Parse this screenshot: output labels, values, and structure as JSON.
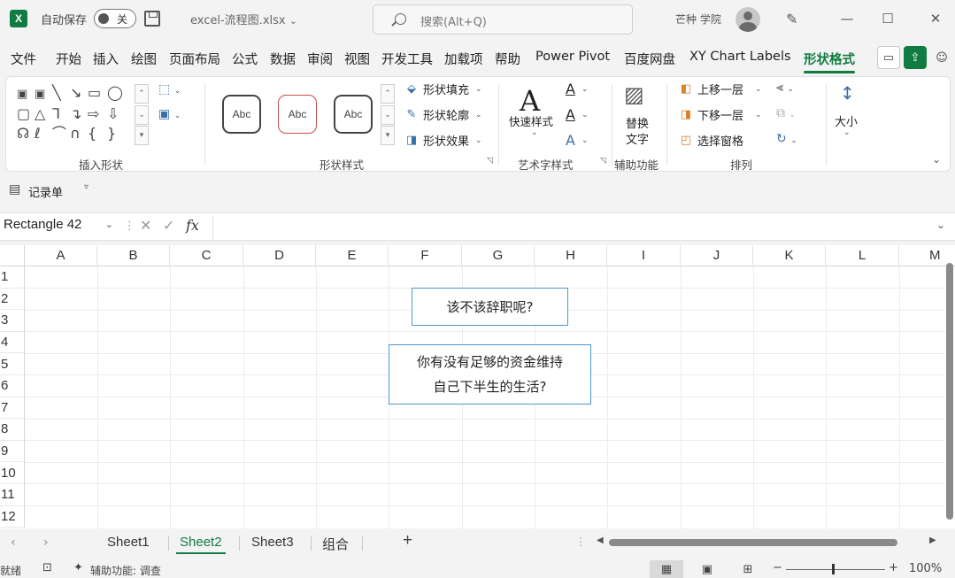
{
  "titlebar": {
    "logo": "X",
    "autosave_label": "自动保存",
    "autosave_state": "关",
    "filename": "excel-流程图.xlsx",
    "filename_caret": "⌄",
    "search_placeholder": "搜索(Alt+Q)",
    "username": "芒种 学院",
    "minimize": "—",
    "maximize": "☐",
    "close": "✕"
  },
  "menu": {
    "tabs": [
      "文件",
      "开始",
      "插入",
      "绘图",
      "页面布局",
      "公式",
      "数据",
      "审阅",
      "视图",
      "开发工具",
      "加载项",
      "帮助",
      "Power Pivot",
      "百度网盘",
      "XY Chart Labels",
      "形状格式"
    ],
    "active_tab": "形状格式"
  },
  "ribbon": {
    "groups": {
      "insert_shapes": "插入形状",
      "shape_styles": "形状样式",
      "wordart_styles": "艺术字样式",
      "accessibility": "辅助功能",
      "arrange": "排列"
    },
    "abc_samples": [
      "Abc",
      "Abc",
      "Abc"
    ],
    "shape_fill": "形状填充",
    "shape_outline": "形状轮廓",
    "shape_effects": "形状效果",
    "quick_styles": "快速样式",
    "alt_text_line1": "替换",
    "alt_text_line2": "文字",
    "bring_forward": "上移一层",
    "send_backward": "下移一层",
    "selection_pane": "选择窗格",
    "size": "大小"
  },
  "qat": {
    "form_label": "记录单"
  },
  "formula_bar": {
    "name_box": "Rectangle 42",
    "fx": "fx",
    "value": ""
  },
  "grid": {
    "columns": [
      "A",
      "B",
      "C",
      "D",
      "E",
      "F",
      "G",
      "H",
      "I",
      "J",
      "K",
      "L",
      "M"
    ],
    "rows": [
      "1",
      "2",
      "3",
      "4",
      "5",
      "6",
      "7",
      "8",
      "9",
      "10",
      "11",
      "12"
    ],
    "shapes": [
      {
        "lines": [
          "该不该辞职呢?"
        ]
      },
      {
        "lines": [
          "你有没有足够的资金维持",
          "自己下半生的生活?"
        ]
      }
    ]
  },
  "sheets": {
    "tabs": [
      "Sheet1",
      "Sheet2",
      "Sheet3",
      "组合"
    ],
    "active": "Sheet2",
    "add": "+"
  },
  "status": {
    "ready": "就绪",
    "accessibility": "辅助功能: 调查",
    "zoom": "100%",
    "zoom_minus": "−",
    "zoom_plus": "+"
  }
}
